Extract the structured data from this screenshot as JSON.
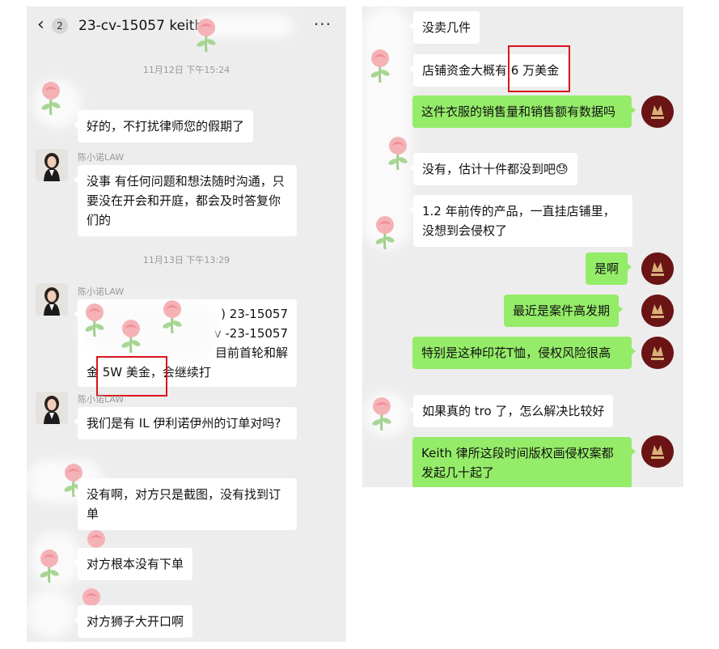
{
  "left_chat": {
    "header": {
      "back_icon": "chevron-left-icon",
      "unread_count": "2",
      "title": "23-cv-15057 keith",
      "more_icon": "ellipsis-icon"
    },
    "time_1": "11月12日 下午15:24",
    "time_2": "11月13日 下午13:29",
    "sender_name": "陈小诺LAW",
    "messages": [
      {
        "from": "other",
        "text": "好的，不打扰律师您的假期了"
      },
      {
        "from": "lawyer",
        "text": "没事 有任何问题和想法随时沟通，只要没在开会和开庭，都会及时答复你们的"
      },
      {
        "from": "lawyer",
        "lines": [
          ") 23-15057",
          "v -23-15057",
          "目前首轮和解",
          "金 5W 美金，会继续打"
        ]
      },
      {
        "from": "lawyer",
        "text": "我们是有 IL 伊利诺伊州的订单对吗?"
      },
      {
        "from": "other",
        "text": "没有啊，对方只是截图，没有找到订单"
      },
      {
        "from": "other",
        "text": "对方根本没有下单"
      },
      {
        "from": "other",
        "text": "对方狮子大开口啊"
      }
    ]
  },
  "right_chat": {
    "messages": [
      {
        "from": "other",
        "text": "没卖几件"
      },
      {
        "from": "other",
        "text": "店铺资金大概有 6 万美金"
      },
      {
        "from": "me",
        "text": "这件衣服的销售量和销售额有数据吗"
      },
      {
        "from": "other",
        "text": "没有，估计十件都没到吧😓"
      },
      {
        "from": "other",
        "text": "1.2 年前传的产品，一直挂店铺里，没想到会侵权了"
      },
      {
        "from": "me",
        "text": "是啊"
      },
      {
        "from": "me",
        "text": "最近是案件高发期"
      },
      {
        "from": "me",
        "text": "特别是这种印花T恤，侵权风险很高"
      },
      {
        "from": "other",
        "text": "如果真的 tro 了，怎么解决比较好"
      },
      {
        "from": "me",
        "text": "Keith 律所这段时间版权画侵权案都发起几十起了"
      }
    ]
  },
  "colors": {
    "chat_bg": "#ededed",
    "bubble_white": "#ffffff",
    "bubble_green": "#95ec69",
    "highlight_box": "#d9141b",
    "firm_avatar": "#6b1416"
  }
}
